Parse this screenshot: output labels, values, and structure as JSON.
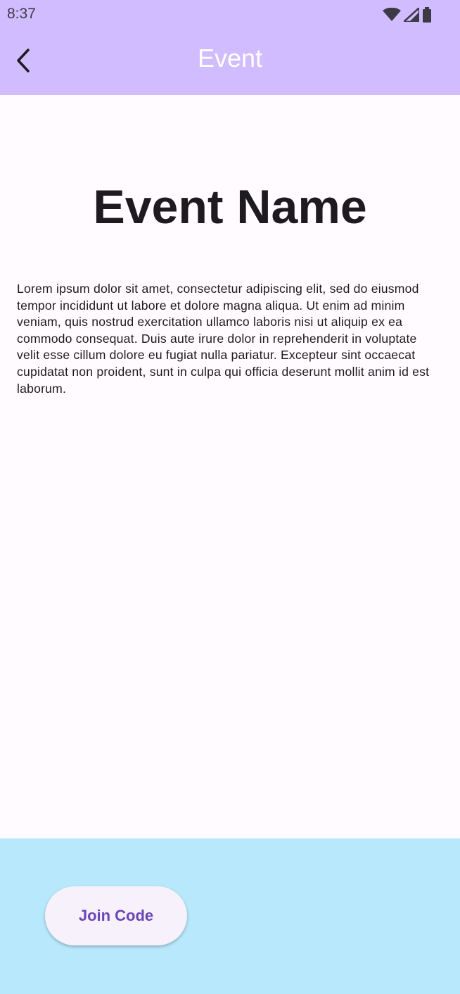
{
  "status_bar": {
    "time": "8:37",
    "icons": [
      "wifi-icon",
      "signal-icon",
      "battery-icon"
    ]
  },
  "app_bar": {
    "title": "Event",
    "back_icon": "arrow-back-icon"
  },
  "event": {
    "name": "Event Name",
    "description": "Lorem ipsum dolor sit amet, consectetur adipiscing elit, sed do eiusmod tempor incididunt ut labore et dolore magna aliqua. Ut enim ad minim veniam, quis nostrud exercitation ullamco laboris nisi ut aliquip ex ea commodo consequat. Duis aute irure dolor in reprehenderit in voluptate velit esse cillum dolore eu fugiat nulla pariatur. Excepteur sint occaecat cupidatat non proident, sunt in culpa qui officia deserunt mollit anim id est laborum."
  },
  "bottom_bar": {
    "join_code_label": "Join Code"
  },
  "colors": {
    "app_bar_bg": "#d0bcff",
    "content_bg": "#fffbfe",
    "bottom_bar_bg": "#b8e8fb",
    "button_bg": "#f6f1fb",
    "button_text": "#6a45b7",
    "title_text": "#1d1b20"
  }
}
